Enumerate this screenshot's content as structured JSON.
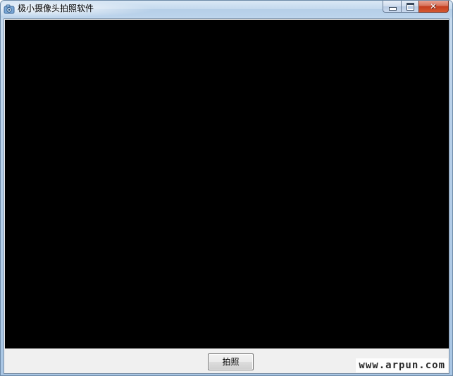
{
  "window": {
    "title": "极小摄像头拍照软件",
    "app_icon": "camera-app-icon"
  },
  "caption_buttons": {
    "minimize": "minimize-icon",
    "maximize": "maximize-icon",
    "close": "close-icon",
    "close_glyph": "✕"
  },
  "preview": {
    "background": "#000000"
  },
  "actions": {
    "capture_label": "拍照"
  },
  "watermark": {
    "text": "www.arpun.com"
  },
  "colors": {
    "titlebar": "#c4d9ee",
    "close_button": "#c43d1f",
    "client_bg": "#f0f0f0"
  }
}
